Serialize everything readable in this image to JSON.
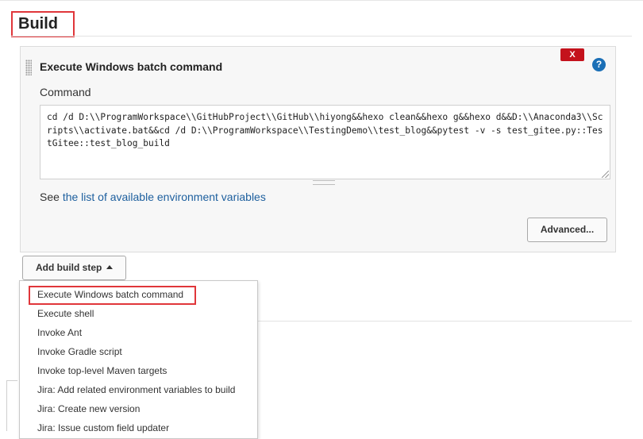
{
  "section": {
    "title": "Build"
  },
  "build_step": {
    "title": "Execute Windows batch command",
    "delete_label": "X",
    "help_label": "?",
    "command_label": "Command",
    "command_value": "cd /d D:\\\\ProgramWorkspace\\\\GitHubProject\\\\GitHub\\\\hiyong&&hexo clean&&hexo g&&hexo d&&D:\\\\Anaconda3\\\\Scripts\\\\activate.bat&&cd /d D:\\\\ProgramWorkspace\\\\TestingDemo\\\\test_blog&&pytest -v -s test_gitee.py::TestGitee::test_blog_build",
    "env_prefix": "See ",
    "env_link": "the list of available environment variables",
    "advanced_label": "Advanced..."
  },
  "add_build_step": {
    "label": "Add build step"
  },
  "dropdown": {
    "items": [
      "Execute Windows batch command",
      "Execute shell",
      "Invoke Ant",
      "Invoke Gradle script",
      "Invoke top-level Maven targets",
      "Jira: Add related environment variables to build",
      "Jira: Create new version",
      "Jira: Issue custom field updater"
    ]
  },
  "colors": {
    "highlight": "#e0363a",
    "link": "#1d5f9e",
    "delete": "#c4121c",
    "help": "#1b6fb6"
  }
}
